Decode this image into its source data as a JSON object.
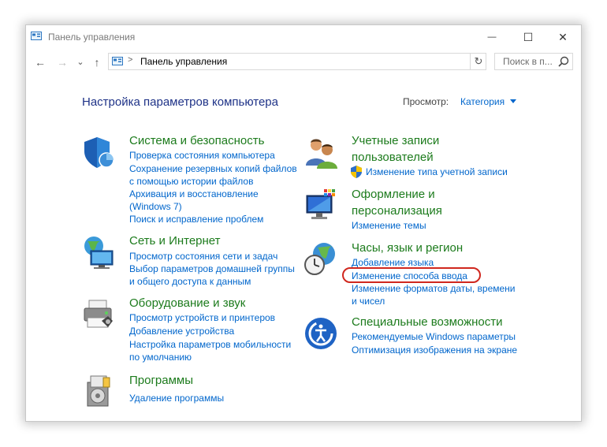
{
  "window": {
    "title": "Панель управления"
  },
  "controls": {
    "minimize": "—",
    "maximize": "☐",
    "close": "✕"
  },
  "nav": {
    "back": "←",
    "forward": "→",
    "dropdown": "⌄",
    "up": "↑"
  },
  "address": {
    "separator": ">",
    "path": "Панель управления",
    "refresh": "↻"
  },
  "search": {
    "placeholder": "Поиск в п..."
  },
  "header": {
    "title": "Настройка параметров компьютера",
    "view_label": "Просмотр:",
    "view_value": "Категория"
  },
  "categories": {
    "system": {
      "title": "Система и безопасность",
      "links": [
        "Проверка состояния компьютера",
        "Сохранение резервных копий файлов",
        "с помощью истории файлов",
        "Архивация и восстановление",
        "(Windows 7)",
        "Поиск и исправление проблем"
      ]
    },
    "network": {
      "title": "Сеть и Интернет",
      "links": [
        "Просмотр состояния сети и задач",
        "Выбор параметров домашней группы",
        "и общего доступа к данным"
      ]
    },
    "hardware": {
      "title": "Оборудование и звук",
      "links": [
        "Просмотр устройств и принтеров",
        "Добавление устройства",
        "Настройка параметров мобильности",
        "по умолчанию"
      ]
    },
    "programs": {
      "title": "Программы",
      "links": [
        "Удаление программы"
      ]
    },
    "accounts": {
      "title_line1": "Учетные записи",
      "title_line2": "пользователей",
      "links": [
        "Изменение типа учетной записи"
      ]
    },
    "appearance": {
      "title_line1": "Оформление и",
      "title_line2": "персонализация",
      "links": [
        "Изменение темы"
      ]
    },
    "clock": {
      "title": "Часы, язык и регион",
      "links": [
        "Добавление языка",
        "Изменение способа ввода",
        "Изменение форматов даты, времени",
        "и чисел"
      ]
    },
    "ease": {
      "title": "Специальные возможности",
      "links": [
        "Рекомендуемые Windows параметры",
        "Оптимизация изображения на экране"
      ]
    }
  },
  "colors": {
    "link": "#0066cc",
    "category_title": "#1c7b1c",
    "heading": "#1e3287",
    "highlight_oval": "#d0271e"
  }
}
